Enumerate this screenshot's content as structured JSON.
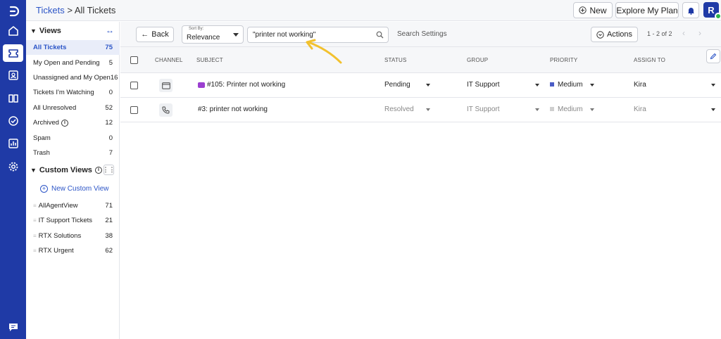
{
  "header": {
    "breadcrumb_parent": "Tickets",
    "breadcrumb_sep": " > ",
    "breadcrumb_current": "All Tickets",
    "new_label": "New",
    "plan_label": "Explore My Plan",
    "avatar_initial": "R"
  },
  "sidebar": {
    "views_title": "Views",
    "items": [
      {
        "label": "All Tickets",
        "count": "75"
      },
      {
        "label": "My Open and Pending",
        "count": "5"
      },
      {
        "label": "Unassigned and My Open",
        "count": "16"
      },
      {
        "label": "Tickets I'm Watching",
        "count": "0"
      },
      {
        "label": "All Unresolved",
        "count": "52"
      },
      {
        "label": "Archived",
        "count": "12"
      },
      {
        "label": "Spam",
        "count": "0"
      },
      {
        "label": "Trash",
        "count": "7"
      }
    ],
    "custom_title": "Custom Views",
    "new_view_label": "New Custom View",
    "custom_items": [
      {
        "label": "AllAgentView",
        "count": "71"
      },
      {
        "label": "IT Support Tickets",
        "count": "21"
      },
      {
        "label": "RTX Solutions",
        "count": "38"
      },
      {
        "label": "RTX Urgent",
        "count": "62"
      }
    ]
  },
  "toolbar": {
    "back_label": "Back",
    "sort_caption": "Sort By:",
    "sort_value": "Relevance",
    "search_query": "\"printer not working\"",
    "search_settings": "Search Settings",
    "actions_label": "Actions",
    "pagination": "1 - 2 of 2"
  },
  "table": {
    "headers": [
      "CHANNEL",
      "SUBJECT",
      "STATUS",
      "GROUP",
      "PRIORITY",
      "ASSIGN TO"
    ],
    "rows": [
      {
        "subject": "#105: Printer not working",
        "status": "Pending",
        "group": "IT Support",
        "priority": "Medium",
        "assignee": "Kira",
        "channel": "email-icon"
      },
      {
        "subject": "#3: printer not working",
        "status": "Resolved",
        "group": "IT Support",
        "priority": "Medium",
        "assignee": "Kira",
        "channel": "phone-icon"
      }
    ]
  },
  "colors": {
    "brand": "#1f3aa6",
    "link": "#2c55c7",
    "priority_medium_active": "#4a5cc5",
    "priority_medium_muted": "#cfcfcf",
    "tag": "#9b3fd0",
    "annotation_arrow": "#f2c12e"
  }
}
